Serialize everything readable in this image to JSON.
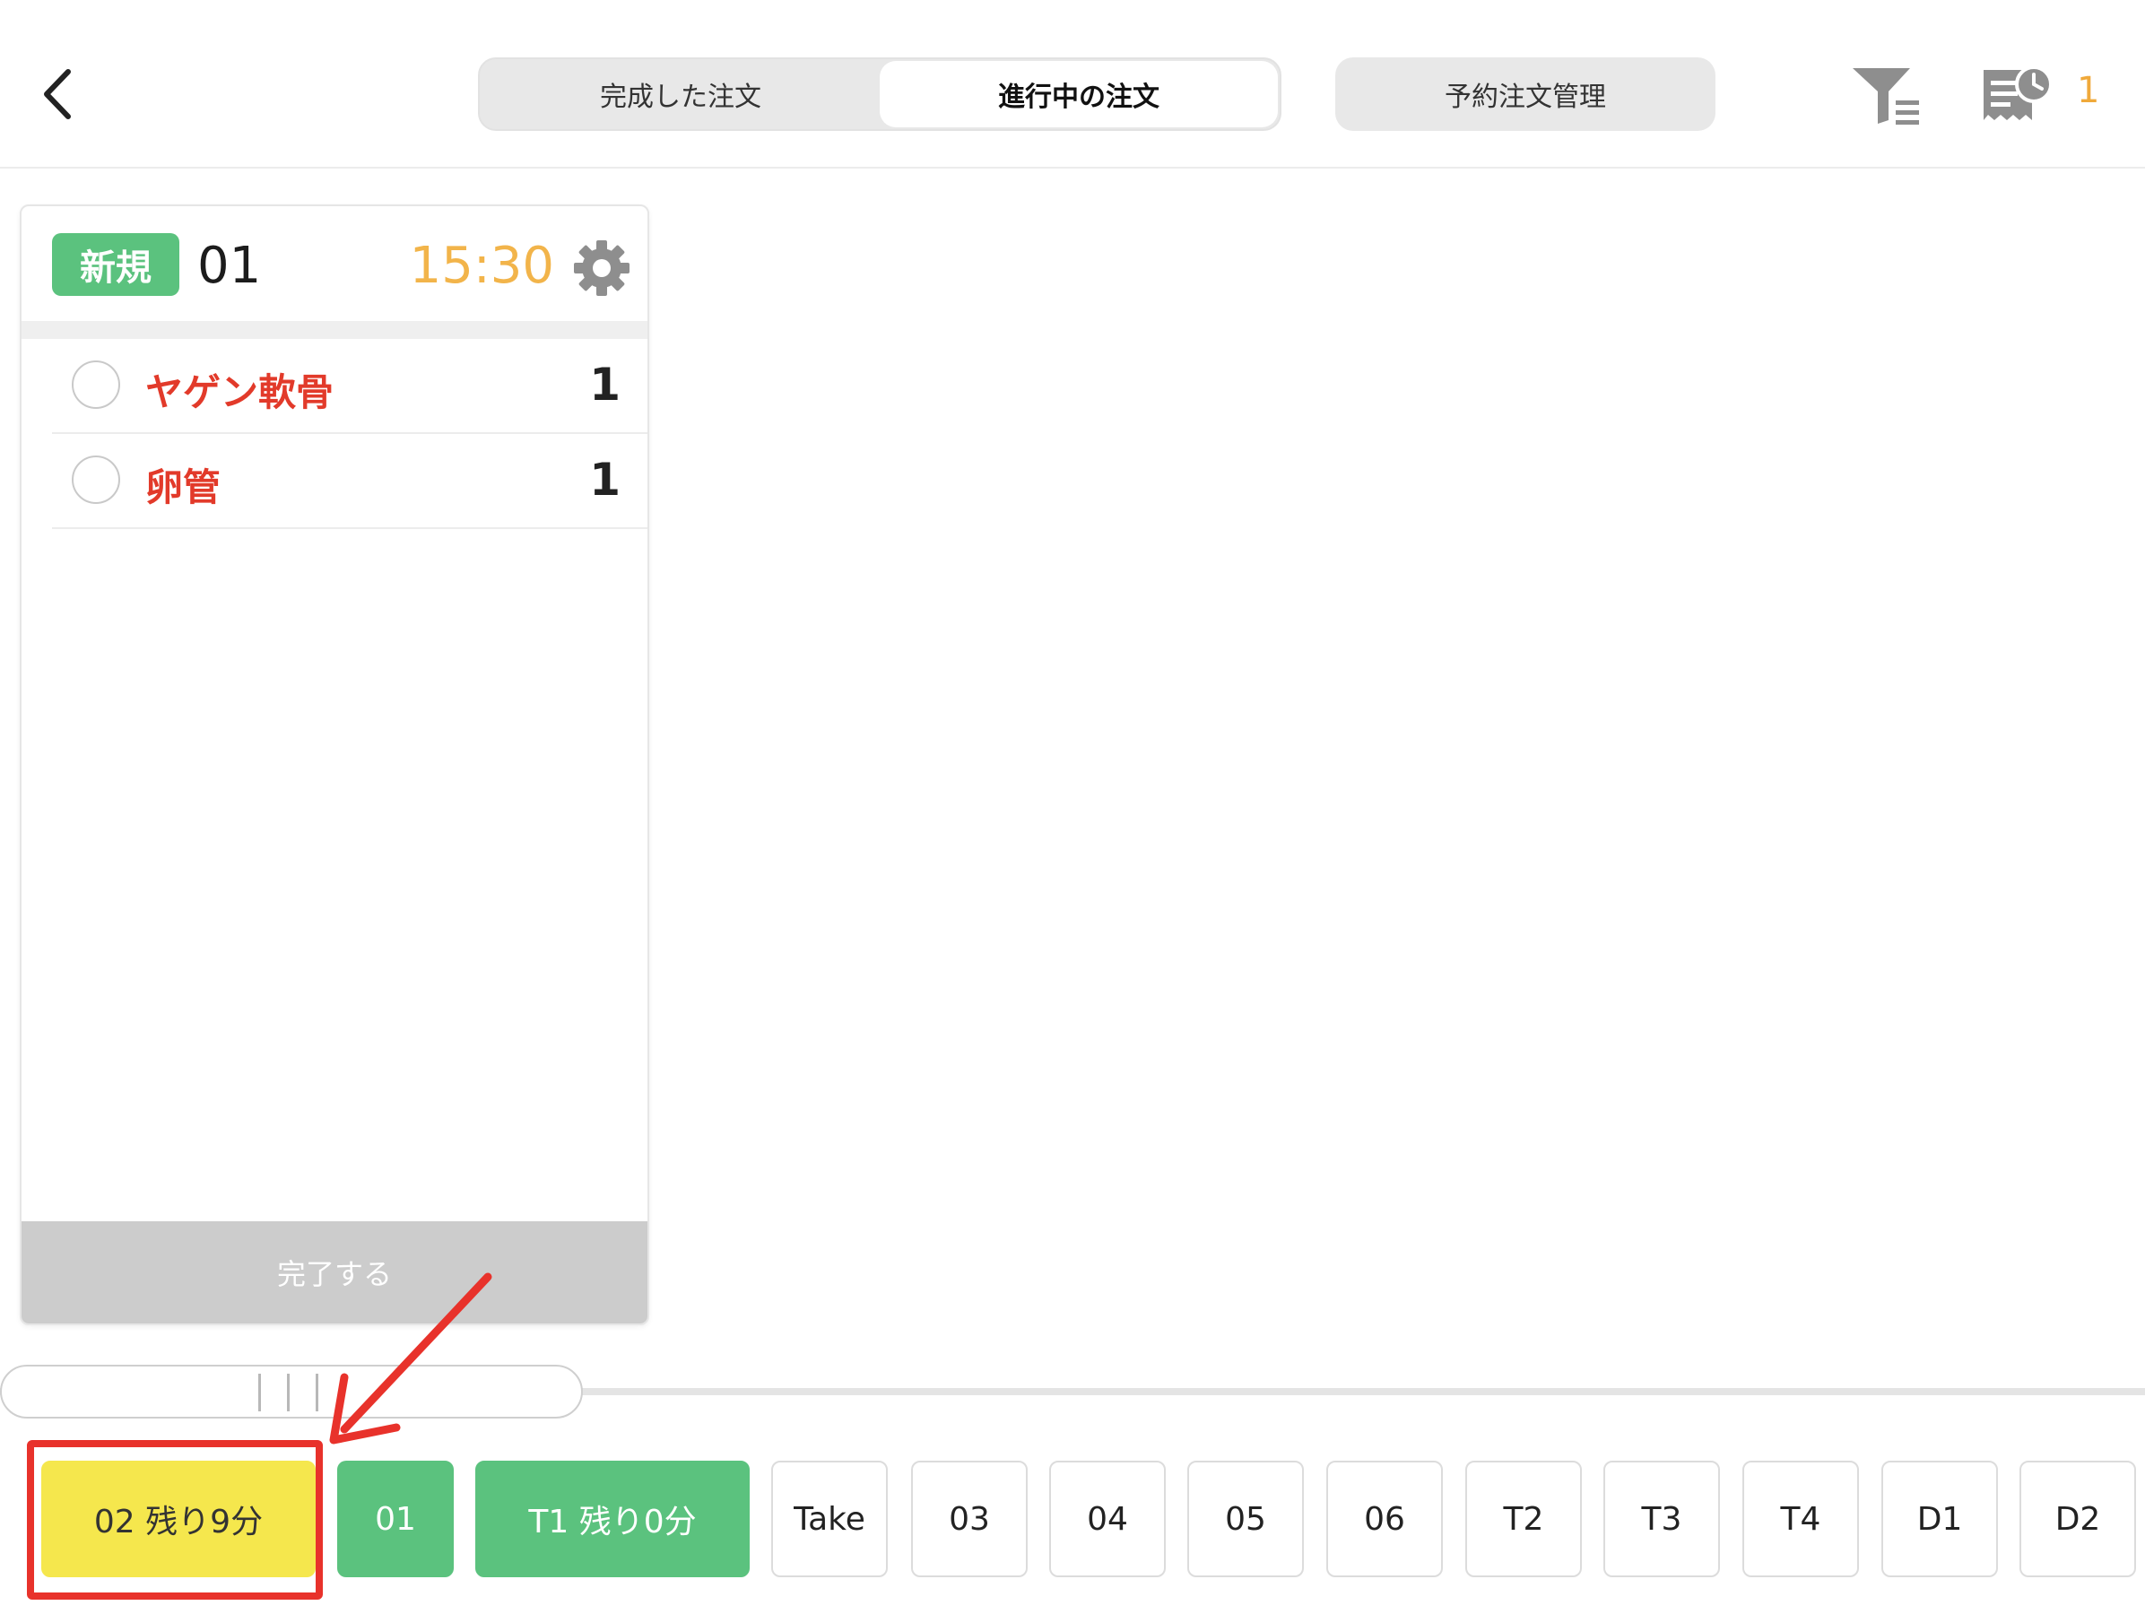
{
  "header": {
    "tabs": [
      {
        "label": "完成した注文",
        "active": false
      },
      {
        "label": "進行中の注文",
        "active": true
      }
    ],
    "reserve_label": "予約注文管理",
    "pending_count": "1"
  },
  "order_card": {
    "badge": "新規",
    "table": "01",
    "time": "15:30",
    "items": [
      {
        "name": "ヤゲン軟骨",
        "qty": "1"
      },
      {
        "name": "卵管",
        "qty": "1"
      }
    ],
    "complete_label": "完了する"
  },
  "tables": [
    {
      "label": "02  残り9分",
      "status": "yellow"
    },
    {
      "label": "01",
      "status": "green"
    },
    {
      "label": "T1  残り0分",
      "status": "green"
    },
    {
      "label": "Take",
      "status": "empty"
    },
    {
      "label": "03",
      "status": "empty"
    },
    {
      "label": "04",
      "status": "empty"
    },
    {
      "label": "05",
      "status": "empty"
    },
    {
      "label": "06",
      "status": "empty"
    },
    {
      "label": "T2",
      "status": "empty"
    },
    {
      "label": "T3",
      "status": "empty"
    },
    {
      "label": "T4",
      "status": "empty"
    },
    {
      "label": "D1",
      "status": "empty"
    },
    {
      "label": "D2",
      "status": "empty"
    }
  ],
  "colors": {
    "accent_green": "#5bc27e",
    "timer_orange": "#f2b44a",
    "item_red": "#e23a2a",
    "chip_yellow": "#f5e74d",
    "annotation_red": "#e8322b"
  },
  "icons": [
    "back-chevron-icon",
    "filter-list-icon",
    "receipt-clock-icon",
    "gear-icon"
  ]
}
